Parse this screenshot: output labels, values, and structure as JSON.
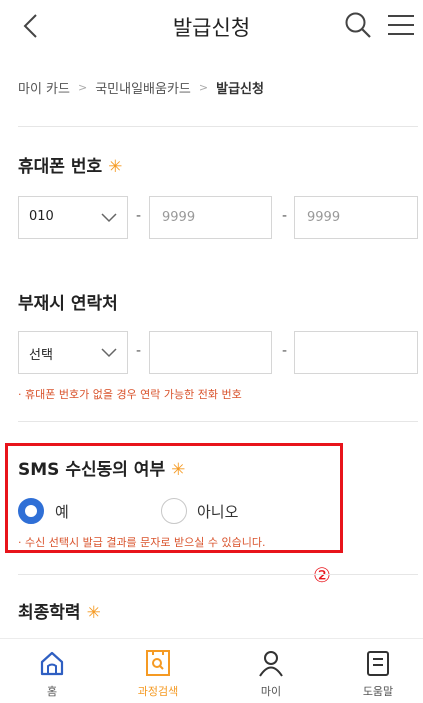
{
  "header": {
    "title": "발급신청",
    "back_icon": "chevron-left-icon",
    "search_icon": "search-icon",
    "menu_icon": "hamburger-menu-icon"
  },
  "breadcrumb": [
    "마이 카드",
    "국민내일배움카드",
    "발급신청"
  ],
  "phone": {
    "label": "휴대폰 번호",
    "required_mark": "✳",
    "prefix": "010",
    "part2": "9999",
    "part3": "9999",
    "dash": "-"
  },
  "alt_contact": {
    "label": "부재시 연락처",
    "select_value": "선택",
    "dash": "-",
    "hint": "· 휴대폰 번호가 없을 경우 연락 가능한 전화 번호"
  },
  "sms": {
    "label": "SMS 수신동의 여부",
    "required_mark": "✳",
    "options": [
      {
        "label": "예",
        "selected": true
      },
      {
        "label": "아니오",
        "selected": false
      }
    ],
    "hint": "· 수신 선택시 발급 결과를 문자로 받으실 수 있습니다.",
    "annotation": "②"
  },
  "education": {
    "label": "최종학력",
    "required_mark": "✳"
  },
  "tabbar": [
    {
      "label": "홈",
      "icon": "home-icon",
      "active": false
    },
    {
      "label": "과정검색",
      "icon": "course-search-icon",
      "active": true
    },
    {
      "label": "마이",
      "icon": "person-icon",
      "active": false
    },
    {
      "label": "도움말",
      "icon": "book-icon",
      "active": false
    }
  ],
  "colors": {
    "accent": "#f59a23",
    "radio": "#2f6fd6",
    "highlight": "#e8141b",
    "hint": "#d9532c"
  }
}
